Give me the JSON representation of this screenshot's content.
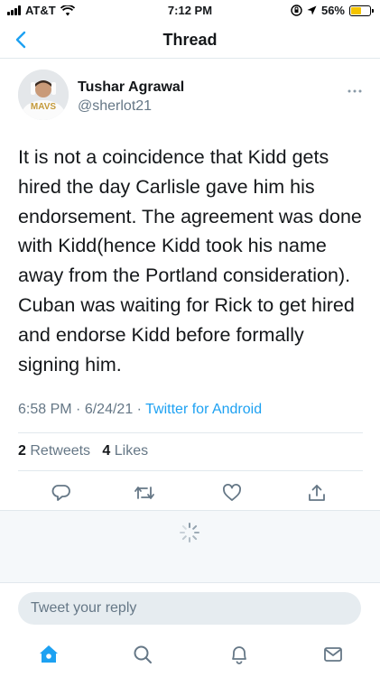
{
  "status_bar": {
    "carrier": "AT&T",
    "time": "7:12 PM",
    "battery_percent": "56%",
    "battery_level": 0.56
  },
  "nav": {
    "title": "Thread",
    "back_icon": "chevron-left-icon"
  },
  "tweet": {
    "author_name": "Tushar Agrawal",
    "author_handle": "@sherlot21",
    "text": "It is not a coincidence that Kidd gets hired the day Carlisle gave him his endorsement. The agreement was done with Kidd(hence Kidd took his name away from the Portland consideration). Cuban was waiting for Rick to get hired and endorse Kidd before formally signing him.",
    "time": "6:58 PM",
    "date": "6/24/21",
    "source": "Twitter for Android",
    "retweets_count": "2",
    "retweets_label": "Retweets",
    "likes_count": "4",
    "likes_label": "Likes",
    "avatar_text": "MAVS"
  },
  "reply": {
    "placeholder": "Tweet your reply"
  },
  "tab_bar": {
    "items": [
      "home-icon",
      "search-icon",
      "notifications-icon",
      "messages-icon"
    ]
  },
  "colors": {
    "accent": "#1da1f2",
    "text": "#14171a",
    "secondary": "#657786",
    "battery": "#f5c400"
  }
}
